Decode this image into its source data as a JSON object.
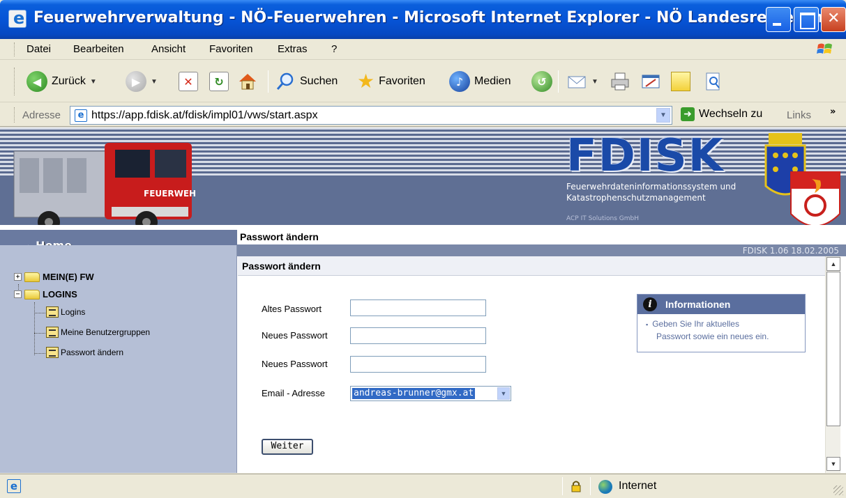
{
  "window": {
    "title": "Feuerwehrverwaltung - NÖ-Feuerwehren - Microsoft Internet Explorer - NÖ Landesregierung"
  },
  "menubar": {
    "items": [
      "Datei",
      "Bearbeiten",
      "Ansicht",
      "Favoriten",
      "Extras",
      "?"
    ]
  },
  "toolbar": {
    "back_label": "Zurück",
    "search_label": "Suchen",
    "favorites_label": "Favoriten",
    "media_label": "Medien"
  },
  "addressbar": {
    "label": "Adresse",
    "url": "https://app.fdisk.at/fdisk/impl01/vws/start.aspx",
    "go_label": "Wechseln zu",
    "links_label": "Links",
    "more": "»"
  },
  "banner": {
    "logo": "FDISK",
    "subtitle_line1": "Feuerwehrdateninformationssystem und",
    "subtitle_line2": "Katastrophenschutzmanagement",
    "company": "ACP IT Solutions GmbH",
    "truck_text": "FEUERWEHR"
  },
  "nav": {
    "home": "Home",
    "breadcrumb": "Passwort ändern",
    "version": "FDISK 1.06 18.02.2005"
  },
  "tree": {
    "nodes": [
      {
        "label": "MEIN(E) FW",
        "expander": "+"
      },
      {
        "label": "LOGINS",
        "expander": "−"
      }
    ],
    "children": [
      "Logins",
      "Meine Benutzergruppen",
      "Passwort ändern"
    ]
  },
  "form": {
    "title": "Passwort ändern",
    "old_password_label": "Altes Passwort",
    "new_password_label": "Neues Passwort",
    "confirm_password_label": "Neues Passwort",
    "email_label": "Email - Adresse",
    "email_value": "andreas-brunner@gmx.at",
    "submit_label": "Weiter"
  },
  "info": {
    "title": "Informationen",
    "text_line1": "Geben Sie Ihr aktuelles",
    "text_line2": "Passwort sowie ein neues ein."
  },
  "status": {
    "zone": "Internet"
  }
}
